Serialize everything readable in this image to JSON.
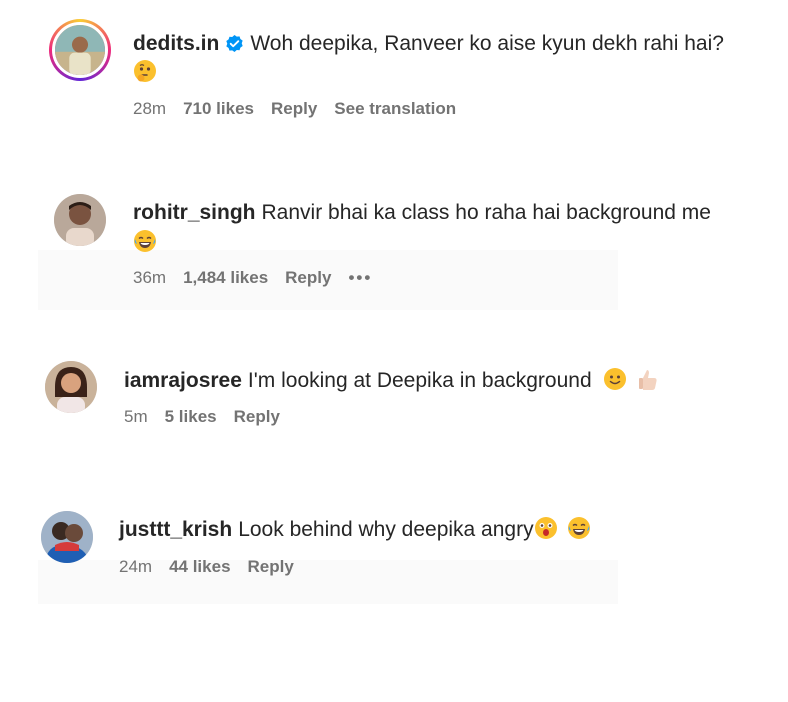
{
  "comments": [
    {
      "username": "dedits.in",
      "verified": true,
      "text": "Woh deepika, Ranveer ko aise kyun dekh rahi hai?",
      "time": "28m",
      "likes": "710 likes",
      "reply": "Reply",
      "extra": "See translation"
    },
    {
      "username": "rohitr_singh",
      "text": "Ranvir bhai ka class ho raha hai background me",
      "time": "36m",
      "likes": "1,484 likes",
      "reply": "Reply",
      "more": "•••"
    },
    {
      "username": "iamrajosree",
      "text": "I'm looking at Deepika in background",
      "time": "5m",
      "likes": "5 likes",
      "reply": "Reply"
    },
    {
      "username": "justtt_krish",
      "text": "Look behind why deepika angry",
      "time": "24m",
      "likes": "44 likes",
      "reply": "Reply"
    }
  ],
  "icons": {
    "verified": "verified-badge-icon",
    "more": "more-options-icon"
  },
  "colors": {
    "verified": "#0095f6",
    "text": "#262626",
    "secondary": "#737373"
  }
}
